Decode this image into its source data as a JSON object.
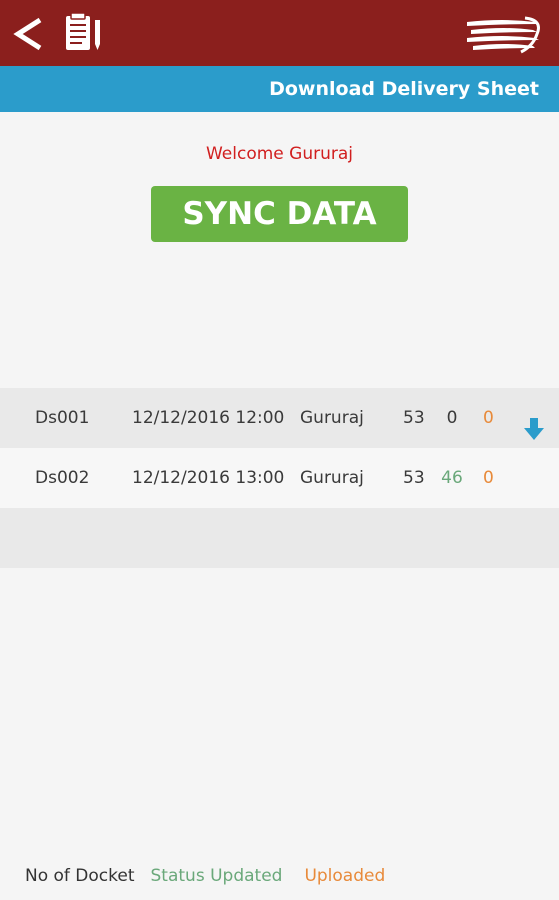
{
  "header": {
    "back_icon": "chevron-left-icon",
    "sheet_icon": "clipboard-pen-icon",
    "logo_icon": "speed-logo-icon",
    "title": "Download Delivery Sheet",
    "bar_color": "#8b1f1d",
    "subbar_color": "#2b9ccb"
  },
  "welcome": "Welcome Gururaj",
  "sync_button": "SYNC DATA",
  "sheets": [
    {
      "id": "Ds001",
      "datetime": "12/12/2016 12:00",
      "name": "Gururaj",
      "docket": "53",
      "status_updated": "0",
      "uploaded": "0",
      "action": "download-arrow-icon"
    },
    {
      "id": "Ds002",
      "datetime": "12/12/2016 13:00",
      "name": "Gururaj",
      "docket": "53",
      "status_updated": "46",
      "uploaded": "0"
    }
  ],
  "legend": {
    "docket": "No of Docket",
    "status": "Status Updated",
    "uploaded": "Uploaded"
  }
}
